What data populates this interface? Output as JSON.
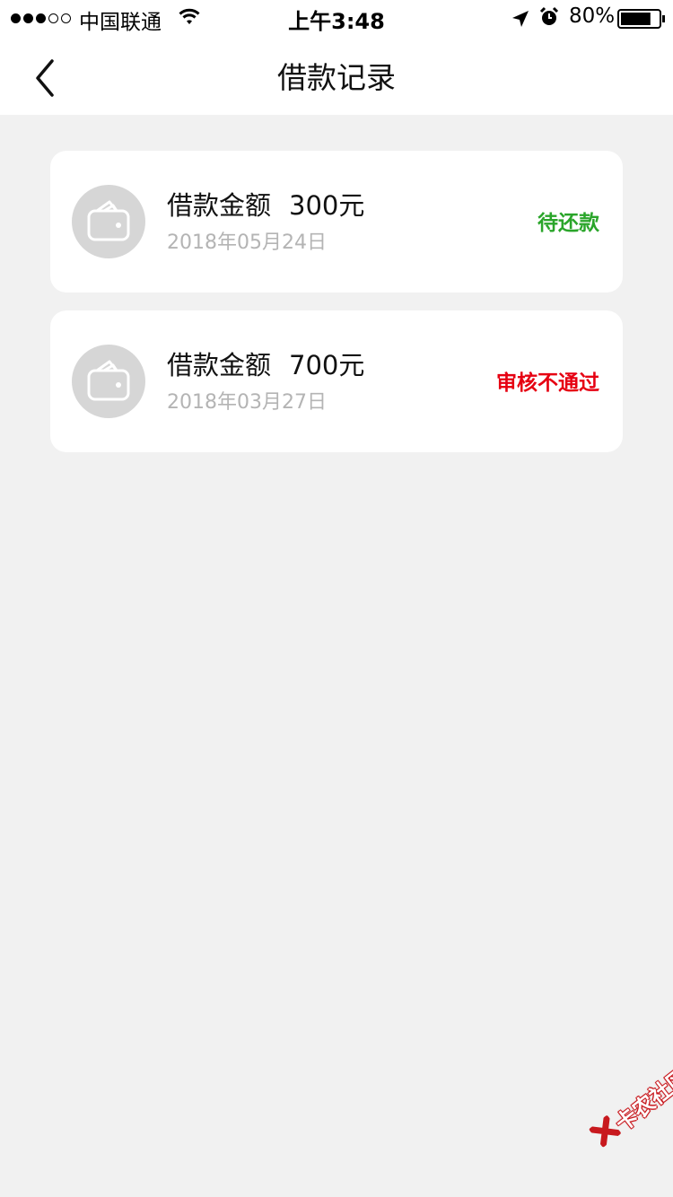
{
  "status_bar": {
    "signal_bars_filled": 3,
    "signal_bars_total": 5,
    "carrier": "中国联通",
    "time": "上午3:48",
    "battery_percent": "80%",
    "battery_level": 0.8,
    "icons": [
      "signal-dots-icon",
      "wifi-icon",
      "location-arrow-icon",
      "alarm-clock-icon",
      "battery-icon"
    ]
  },
  "nav": {
    "back_icon": "chevron-left-icon",
    "title": "借款记录"
  },
  "records": [
    {
      "icon": "wallet-icon",
      "amount_label": "借款金额",
      "amount": "300元",
      "date": "2018年05月24日",
      "status": "待还款",
      "status_color": "#2aa52a"
    },
    {
      "icon": "wallet-icon",
      "amount_label": "借款金额",
      "amount": "700元",
      "date": "2018年03月27日",
      "status": "审核不通过",
      "status_color": "#e60012"
    }
  ],
  "watermark": {
    "text": "卡农社区",
    "color": "#c8191e"
  }
}
